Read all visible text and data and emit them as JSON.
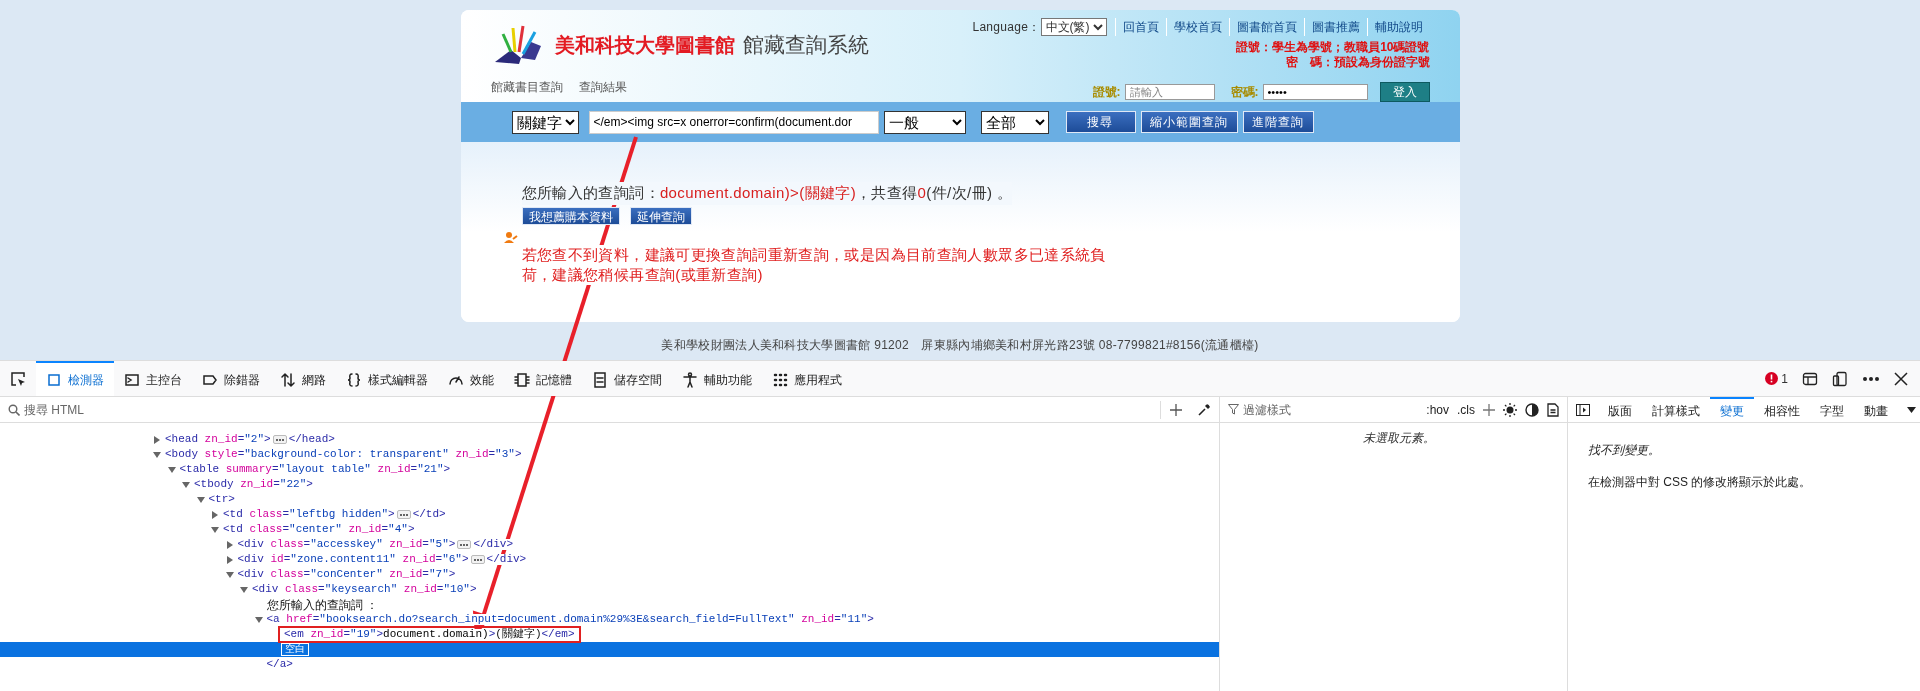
{
  "header": {
    "library_name": "美和科技大學圖書館",
    "system_name": "館藏查詢系統",
    "language_label": "Language：",
    "language_value": "中文(繁)",
    "nav_links": [
      "回首頁",
      "學校首頁",
      "圖書館首頁",
      "圖書推薦",
      "輔助說明"
    ],
    "notices": [
      "證號：學生為學號；教職員10碼證號",
      "密　碼：預設為身份證字號"
    ],
    "breadcrumb": [
      "館藏書目查詢",
      "查詢結果"
    ],
    "login": {
      "id_label": "證號:",
      "id_placeholder": "請輸入",
      "password_label": "密碼:",
      "password_value": "•••••",
      "button": "登入"
    }
  },
  "search_bar": {
    "field": "關鍵字",
    "query": "</em><img src=x onerror=confirm(document.dor",
    "type": "一般",
    "scope": "全部",
    "buttons": [
      "搜尋",
      "縮小範圍查詢",
      "進階查詢"
    ]
  },
  "result": {
    "summary": [
      {
        "text": "您所輸入的查詢詞：",
        "highlight": false
      },
      {
        "text": "document.domain)>(關鍵字)",
        "highlight": true
      },
      {
        "text": "，共查得",
        "highlight": false
      },
      {
        "text": "0",
        "highlight": true
      },
      {
        "text": "(件/次/冊) 。",
        "highlight": false
      }
    ],
    "buttons": [
      "我想薦購本資料",
      "延伸查詢"
    ],
    "notice": "若您查不到資料，建議可更換查詢詞重新查詢，或是因為目前查詢人數眾多已達系統負荷，建議您稍候再查詢(或重新查詢)"
  },
  "footer": "美和學校財團法人美和科技大學圖書館 91202　屏東縣內埔鄉美和村屏光路23號 08-7799821#8156(流通櫃檯)",
  "devtools": {
    "tabs": [
      {
        "label": "檢測器",
        "selected": true
      },
      {
        "label": "主控台",
        "selected": false
      },
      {
        "label": "除錯器",
        "selected": false
      },
      {
        "label": "網路",
        "selected": false
      },
      {
        "label": "樣式編輯器",
        "selected": false
      },
      {
        "label": "效能",
        "selected": false
      },
      {
        "label": "記憶體",
        "selected": false
      },
      {
        "label": "儲存空間",
        "selected": false
      },
      {
        "label": "輔助功能",
        "selected": false
      },
      {
        "label": "應用程式",
        "selected": false
      }
    ],
    "error_count": "1",
    "html_search_placeholder": "搜尋 HTML",
    "dom_tree": [
      {
        "kind": "element",
        "text": "<head zn_id=\"2\">",
        "close": "</head>",
        "expanded": false,
        "selected": false,
        "annotated": false
      },
      {
        "kind": "element",
        "text": "<body style=\"background-color: transparent\" zn_id=\"3\">",
        "expanded": true,
        "selected": false,
        "annotated": false,
        "children": [
          {
            "kind": "element",
            "text": "<table summary=\"layout table\" zn_id=\"21\">",
            "expanded": true,
            "selected": false,
            "annotated": false,
            "children": [
              {
                "kind": "element",
                "text": "<tbody zn_id=\"22\">",
                "expanded": true,
                "selected": false,
                "annotated": false,
                "children": [
                  {
                    "kind": "element",
                    "text": "<tr>",
                    "expanded": true,
                    "selected": false,
                    "annotated": false,
                    "children": [
                      {
                        "kind": "element",
                        "text": "<td class=\"leftbg hidden\">",
                        "close": "</td>",
                        "expanded": false,
                        "selected": false,
                        "annotated": false
                      },
                      {
                        "kind": "element",
                        "text": "<td class=\"center\" zn_id=\"4\">",
                        "expanded": true,
                        "selected": false,
                        "annotated": false,
                        "children": [
                          {
                            "kind": "element",
                            "text": "<div class=\"accesskey\" zn_id=\"5\">",
                            "close": "</div>",
                            "expanded": false,
                            "selected": false,
                            "annotated": false
                          },
                          {
                            "kind": "element",
                            "text": "<div id=\"zone.content11\" zn_id=\"6\">",
                            "close": "</div>",
                            "expanded": false,
                            "selected": false,
                            "annotated": false
                          },
                          {
                            "kind": "element",
                            "text": "<div class=\"conCenter\" zn_id=\"7\">",
                            "expanded": true,
                            "selected": false,
                            "annotated": false,
                            "children": [
                              {
                                "kind": "element",
                                "text": "<div class=\"keysearch\" zn_id=\"10\">",
                                "expanded": true,
                                "selected": false,
                                "annotated": false,
                                "children": [
                                  {
                                    "kind": "text",
                                    "text": "您所輸入的查詢詞 ：",
                                    "selected": false,
                                    "annotated": false
                                  },
                                  {
                                    "kind": "link",
                                    "text": "<a href=\"booksearch.do?search_input=document.domain%29%3E&search_field=FullText\" zn_id=\"11\">",
                                    "close": "</a>",
                                    "expanded": true,
                                    "selected": false,
                                    "annotated": false,
                                    "children": [
                                      {
                                        "kind": "leaf",
                                        "text": "<em zn_id=\"19\">document.domain)>(關鍵字)</em>",
                                        "selected": false,
                                        "annotated": true
                                      },
                                      {
                                        "kind": "whitespace",
                                        "text": "空白",
                                        "selected": true,
                                        "annotated": false
                                      }
                                    ]
                                  }
                                ]
                              }
                            ]
                          }
                        ]
                      }
                    ]
                  }
                ]
              }
            ]
          }
        ]
      }
    ],
    "styles": {
      "filter_placeholder": "過濾樣式",
      "hov": ":hov",
      "cls": ".cls",
      "empty": "未選取元素。"
    },
    "side_tabs": [
      {
        "label": "版面",
        "selected": false
      },
      {
        "label": "計算樣式",
        "selected": false
      },
      {
        "label": "變更",
        "selected": true
      },
      {
        "label": "相容性",
        "selected": false
      },
      {
        "label": "字型",
        "selected": false
      },
      {
        "label": "動畫",
        "selected": false
      }
    ],
    "changes": {
      "empty": "找不到變更。",
      "hint": "在檢測器中對 CSS 的修改將顯示於此處。"
    }
  }
}
